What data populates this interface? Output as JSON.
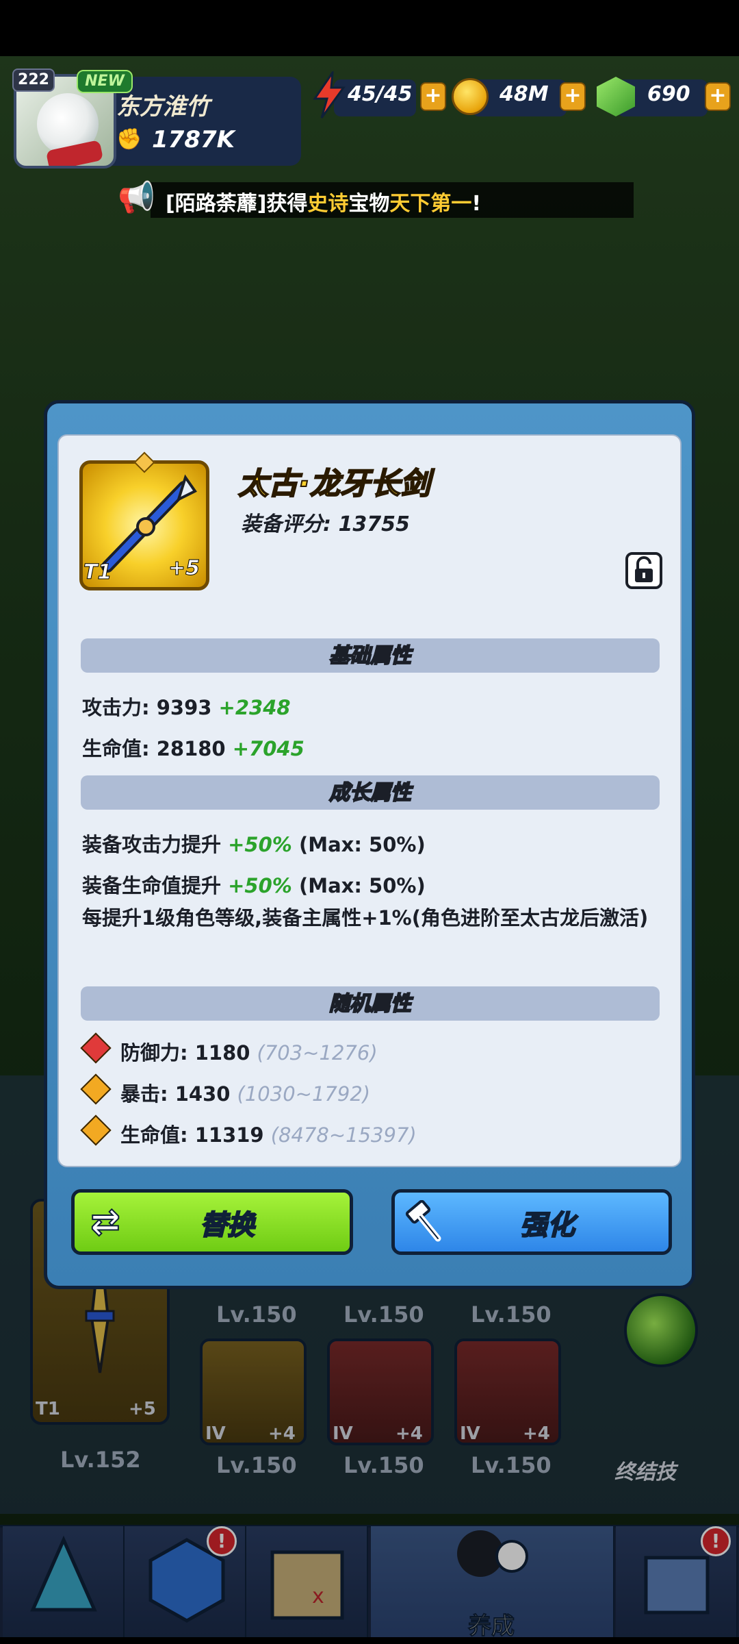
{
  "hud": {
    "level": "222",
    "new_badge": "NEW",
    "player_name": "东方淮竹",
    "power": "1787K",
    "energy": "45/45",
    "coins": "48M",
    "gems": "690",
    "plus": "+"
  },
  "ticker": {
    "prefix": "[陌路荼蘼]获得",
    "rarity": "史诗",
    "mid": "宝物",
    "item": "天下第一",
    "suffix": "!"
  },
  "item": {
    "tier": "T1",
    "plus": "+5",
    "name": "太古·龙牙长剑",
    "score_label": "装备评分:",
    "score_value": "13755"
  },
  "sections": {
    "basic": "基础属性",
    "growth": "成长属性",
    "random": "随机属性"
  },
  "basic_stats": [
    {
      "label": "攻击力:",
      "value": "9393",
      "bonus": "+2348"
    },
    {
      "label": "生命值:",
      "value": "28180",
      "bonus": "+7045"
    }
  ],
  "growth_stats": [
    {
      "label": "装备攻击力提升",
      "bonus": "+50%",
      "max": "(Max: 50%)"
    },
    {
      "label": "装备生命值提升",
      "bonus": "+50%",
      "max": "(Max: 50%)"
    }
  ],
  "growth_desc": "每提升1级角色等级,装备主属性+1%(角色进阶至太古龙后激活)",
  "random_stats": [
    {
      "label": "防御力:",
      "value": "1180",
      "range": "(703~1276)",
      "color": "#e03a3a"
    },
    {
      "label": "暴击:",
      "value": "1430",
      "range": "(1030~1792)",
      "color": "#f2a922"
    },
    {
      "label": "生命值:",
      "value": "11319",
      "range": "(8478~15397)",
      "color": "#f2a922"
    }
  ],
  "buttons": {
    "replace": "替换",
    "enhance": "强化"
  },
  "equip": {
    "main_tier": "T1",
    "main_plus": "+5",
    "main_level": "Lv.152",
    "slot_levels": [
      "Lv.150",
      "Lv.150",
      "Lv.150",
      "Lv.150",
      "Lv.150",
      "Lv.150"
    ],
    "slot_tag": "IV",
    "slot_plus": "+4",
    "ultimate_label": "终结技"
  },
  "nav": {
    "active_label": "养成",
    "badge": "!"
  }
}
